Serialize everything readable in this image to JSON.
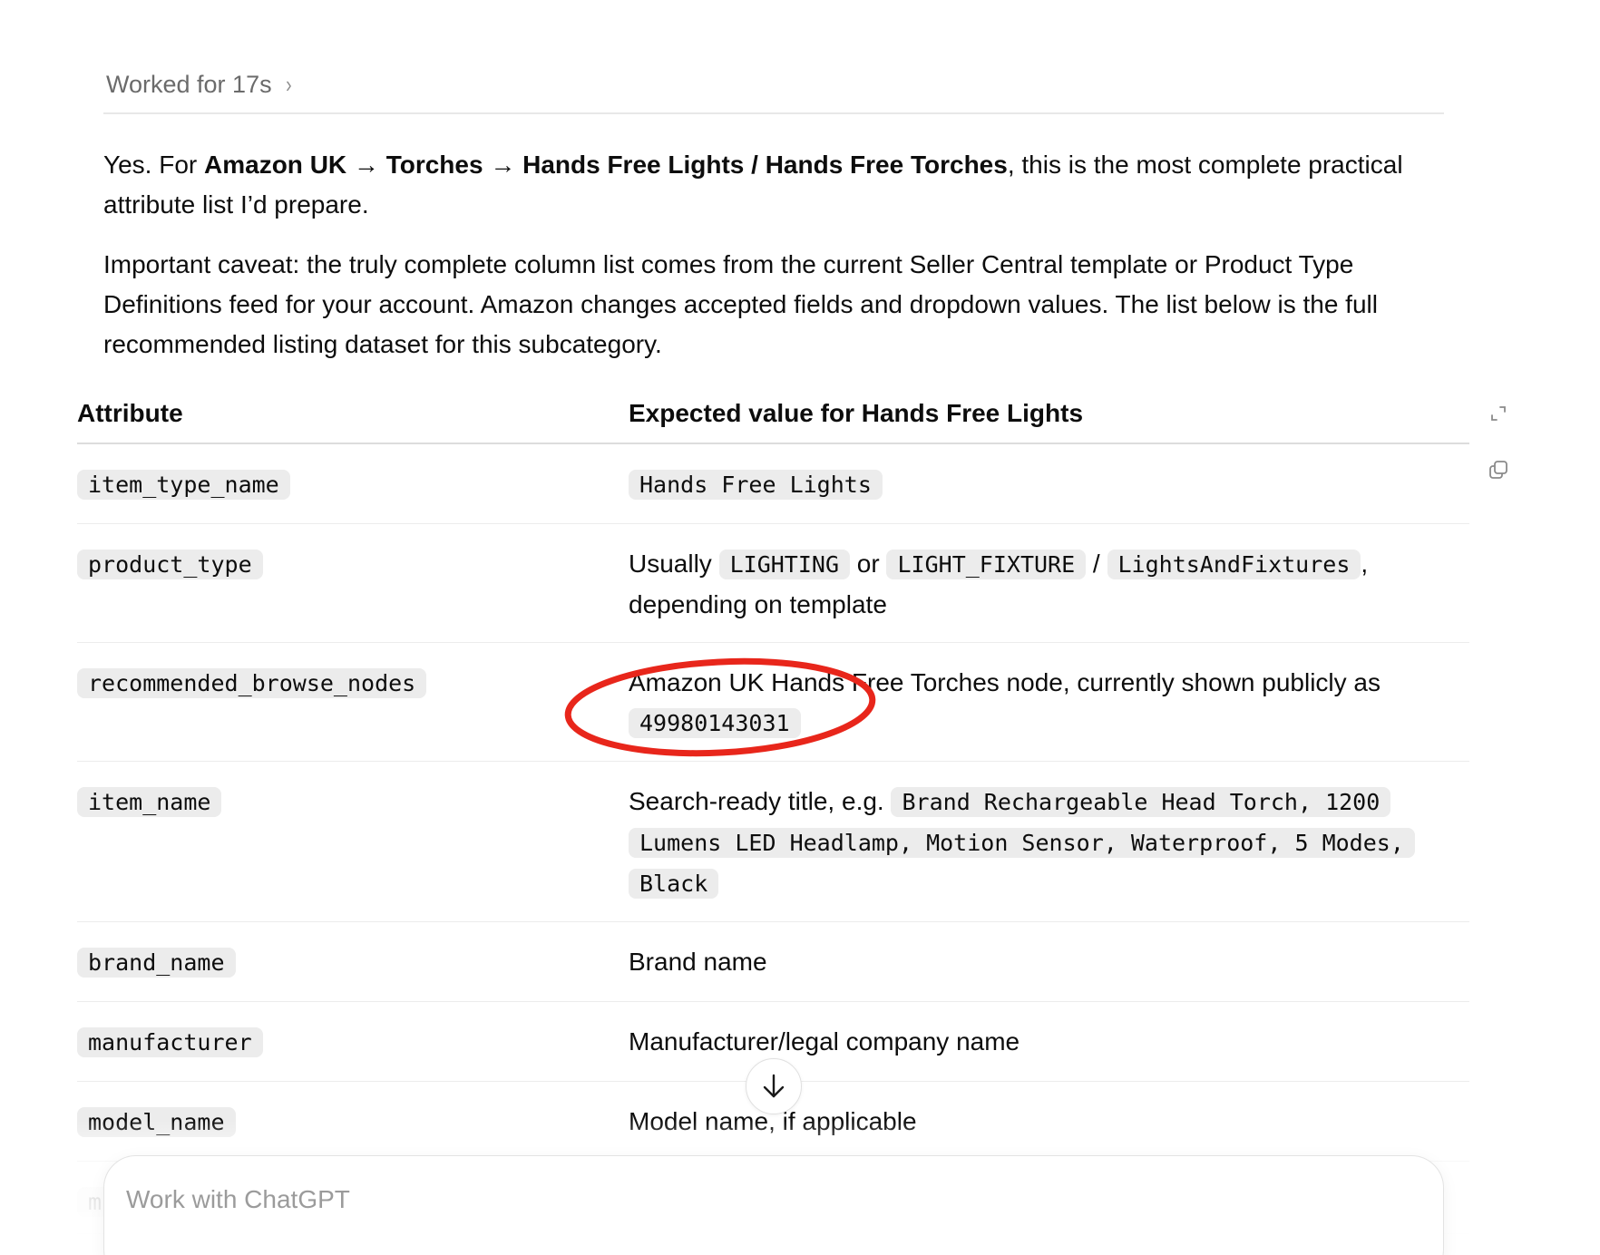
{
  "worked": {
    "label": "Worked for 17s",
    "chevron": "›"
  },
  "intro": {
    "prefix": "Yes. For ",
    "bold_path": "Amazon UK → Torches → Hands Free Lights / Hands Free Torches",
    "suffix": ", this is the most complete practical attribute list I’d prepare."
  },
  "caveat": "Important caveat: the truly complete column list comes from the current Seller Central template or Product Type Definitions feed for your account. Amazon changes accepted fields and dropdown values. The list below is the full recommended listing dataset for this subcategory.",
  "table": {
    "headers": [
      "Attribute",
      "Expected value for Hands Free Lights"
    ],
    "rows": [
      {
        "attr": "item_type_name",
        "value_code": "Hands Free Lights"
      },
      {
        "attr": "product_type",
        "text1": "Usually ",
        "code1": "LIGHTING",
        "text2": " or ",
        "code2": "LIGHT_FIXTURE",
        "text3": " / ",
        "code3": "LightsAndFixtures",
        "text4": ", depending on template"
      },
      {
        "attr": "recommended_browse_nodes",
        "text1": "Amazon UK Hands Free Torches node, currently shown publicly as ",
        "code1": "49980143031"
      },
      {
        "attr": "item_name",
        "text1": "Search-ready title, e.g. ",
        "code1": "Brand Rechargeable Head Torch, 1200 Lumens LED Headlamp, Motion Sensor, Waterproof, 5 Modes, Black"
      },
      {
        "attr": "brand_name",
        "text1": "Brand name"
      },
      {
        "attr": "manufacturer",
        "text1": "Manufacturer/legal company name"
      },
      {
        "attr": "model_name",
        "text1": "Model name, if applicable"
      },
      {
        "attr": "m"
      }
    ]
  },
  "annotation": {
    "color": "#e8261b"
  },
  "composer": {
    "placeholder": "Work with ChatGPT"
  },
  "icons": [
    "chevron-right-icon",
    "expand-icon",
    "copy-icon",
    "arrow-down-icon"
  ]
}
